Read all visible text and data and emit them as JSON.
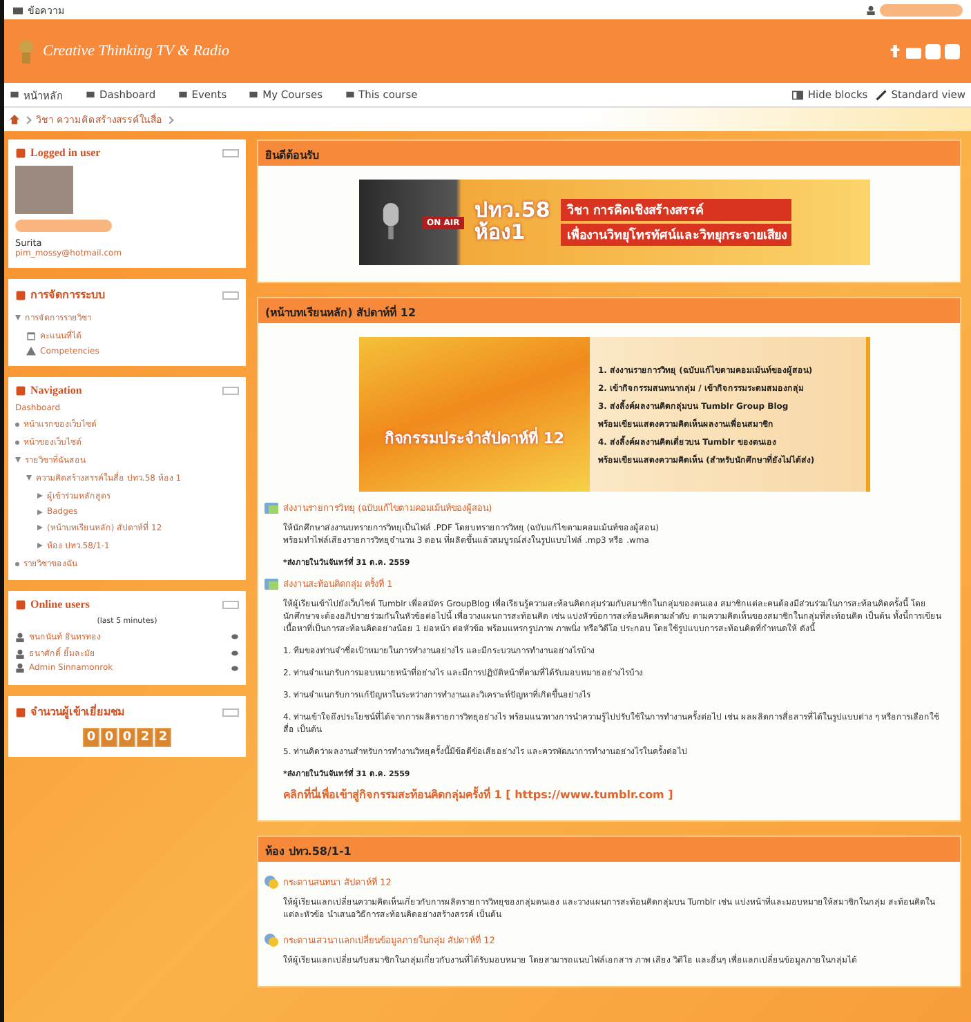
{
  "top_bar": {
    "messages": "ข้อความ"
  },
  "header": {
    "site_name": "Creative Thinking TV & Radio"
  },
  "nav": {
    "items": [
      {
        "label": "หน้าหลัก"
      },
      {
        "label": "Dashboard"
      },
      {
        "label": "Events"
      },
      {
        "label": "My Courses"
      },
      {
        "label": "This course"
      }
    ],
    "hide_blocks": "Hide blocks",
    "standard_view": "Standard view"
  },
  "breadcrumb": [
    "วิชา ความคิดสร้างสรรค์ในสื่อ"
  ],
  "blocks": [
    {
      "kind": "user",
      "title": "Logged in user",
      "name": "Surita",
      "email": "pim_mossy@hotmail.com"
    },
    {
      "kind": "tree",
      "title": "การจัดการระบบ",
      "items": [
        {
          "label": "การจัดการรายวิชา",
          "expanded": true,
          "children": [
            {
              "label": "คะแนนที่ได้"
            },
            {
              "label": "Competencies"
            }
          ]
        }
      ]
    },
    {
      "kind": "tree",
      "title": "Navigation",
      "lead": "Dashboard",
      "items": [
        {
          "label": "หน้าแรกของเว็บไซต์"
        },
        {
          "label": "หน้าของเว็บไซต์"
        },
        {
          "label": "รายวิชาที่ฉันสอน",
          "expanded": true,
          "children": [
            {
              "label": "ความคิดสร้างสรรค์ในสื่อ ปทว.58 ห้อง 1",
              "expanded": true,
              "children": [
                {
                  "label": "ผู้เข้าร่วมหลักสูตร",
                  "expanded": false
                },
                {
                  "label": "Badges",
                  "expanded": false
                },
                {
                  "label": "(หน้าบทเรียนหลัก) สัปดาห์ที่ 12",
                  "expanded": false
                },
                {
                  "label": "ห้อง ปทว.58/1-1",
                  "expanded": false
                }
              ]
            }
          ]
        },
        {
          "label": "รายวิชาของฉัน"
        }
      ]
    },
    {
      "kind": "online",
      "title": "Online users",
      "note": "(last 5 minutes)",
      "users": [
        "ชนกนันท์ อินทรทอง",
        "ธนาศักดิ์ ยิ้มละมัย",
        "Admin Sinnamonrok"
      ]
    },
    {
      "kind": "counter",
      "title": "จำนวนผู้เข้าเยี่ยมชม",
      "digits": [
        "0",
        "0",
        "0",
        "2",
        "2"
      ]
    }
  ],
  "sections": [
    {
      "title": "ยินดีต้อนรับ",
      "banner": {
        "kind": "welcome",
        "onair": "ON AIR",
        "big": "ปทว.58",
        "room": "ห้อง1",
        "line1": "วิชา การคิดเชิงสร้างสรรค์",
        "line2": "เพื่องานวิทยุโทรทัศน์และวิทยุกระจายเสียง"
      }
    },
    {
      "title": "(หน้าบทเรียนหลัก) สัปดาห์ที่ 12",
      "banner": {
        "kind": "week",
        "caption": "กิจกรรมประจำสัปดาห์ที่ 12",
        "lines": [
          "1. ส่งงานรายการวิทยุ (ฉบับแก้ไขตามคอมเม้นท์ของผู้สอน)",
          "2. เข้ากิจกรรมสนทนากลุ่ม / เข้ากิจกรรมระดมสมองกลุ่ม",
          "3. ส่งลิ้งค์ผลงานคิดกลุ่มบน Tumblr Group Blog",
          "พร้อมเขียนแสดงความคิดเห็นผลงานเพื่อนสมาชิก",
          "4. ส่งลิ้งค์ผลงานคิดเดี่ยวบน Tumblr ของตนเอง",
          "พร้อมเขียนแสดงความคิดเห็น (สำหรับนักศึกษาที่ยังไม่ได้ส่ง)"
        ]
      },
      "activities": [
        {
          "kind": "assignment",
          "title": "ส่งงานรายการวิทยุ (ฉบับแก้ไขตามคอมเม้นท์ของผู้สอน)",
          "body": [
            {
              "kind": "text",
              "text": "ให้นักศึกษาส่งงานบทรายการวิทยุเป็นไฟล์ .PDF โดยบทรายการวิทยุ (ฉบับแก้ไขตามคอมเม้นท์ของผู้สอน)\nพร้อมทำไฟล์เสียงรายการวิทยุจำนวน 3 ตอน ที่ผลิตขึ้นแล้วสมบูรณ์ส่งในรูปแบบไฟล์ .mp3 หรือ .wma"
            },
            {
              "kind": "deadline",
              "text": "*ส่งภายในวันจันทร์ที่ 31 ต.ค. 2559"
            }
          ]
        },
        {
          "kind": "assignment",
          "title": "ส่งงานสะท้อนคิดกลุ่ม ครั้งที่ 1",
          "body": [
            {
              "kind": "text",
              "text": "ให้ผู้เรียนเข้าไปยังเว็บไซต์ Tumblr เพื่อสมัคร GroupBlog เพื่อเรียนรู้ความสะท้อนคิดกลุ่มร่วมกับสมาชิกในกลุ่มของตนเอง สมาชิกแต่ละคนต้องมีส่วนร่วมในการสะท้อนคิดครั้งนี้ โดยนักศึกษาจะต้องอภิปรายร่วมกันในหัวข้อต่อไปนี้ เพื่อวางแผนการสะท้อนคิด เช่น แบ่งหัวข้อการสะท้อนคิดตามลำดับ ตามความคิดเห็นของสมาชิกในกลุ่มที่สะท้อนคิด เป็นต้น ทั้งนี้การเขียนเนื้อหาที่เป็นการสะท้อนคิดอย่างน้อย 1 ย่อหน้า ต่อหัวข้อ พร้อมแทรกรูปภาพ ภาพนิ่ง หรือวิดีโอ ประกอบ โดยใช้รูปแบบการสะท้อนคิดที่กำหนดให้ ดังนี้"
            },
            {
              "kind": "text",
              "text": "1. ทีมของท่านจำชื่อเป้าหมายในการทำงานอย่างไร และมีกระบวนการทำงานอย่างไรบ้าง"
            },
            {
              "kind": "text",
              "text": "2. ท่านจำแนกรับการมอบหมายหน้าที่อย่างไร และมีการปฏิบัติหน้าที่ตามที่ได้รับมอบหมายอย่างไรบ้าง"
            },
            {
              "kind": "text",
              "text": "3. ท่านจำแนกรับการแก้ปัญหาในระหว่างการทำงานและวิเคราะห์ปัญหาที่เกิดขึ้นอย่างไร"
            },
            {
              "kind": "text",
              "text": "4. ท่านเข้าใจถึงประโยชน์ที่ได้จากการผลิตรายการวิทยุอย่างไร พร้อมแนวทางการนำความรู้ไปปรับใช้ในการทำงานครั้งต่อไป เช่น ผลผลิตการสื่อสารที่ได้ในรูปแบบต่าง ๆ หรือการเลือกใช้สื่อ เป็นต้น"
            },
            {
              "kind": "text",
              "text": "5. ท่านคิดว่าผลงานสำหรับการทำงานวิทยุครั้งนี้มีข้อดีข้อเสียอย่างไร และควรพัฒนาการทำงานอย่างไรในครั้งต่อไป"
            },
            {
              "kind": "deadline",
              "text": "*ส่งภายในวันจันทร์ที่ 31 ต.ค. 2559"
            },
            {
              "kind": "link",
              "text": "คลิกที่นี่เพื่อเข้าสู่กิจกรรมสะท้อนคิดกลุ่มครั้งที่ 1 [ https://www.tumblr.com ]"
            }
          ]
        }
      ]
    },
    {
      "title": "ห้อง ปทว.58/1-1",
      "activities": [
        {
          "kind": "forum",
          "title": "กระดานสนทนา สัปดาห์ที่ 12",
          "body": [
            {
              "kind": "text",
              "text": "ให้ผู้เรียนแลกเปลี่ยนความคิดเห็นเกี่ยวกับการผลิตรายการวิทยุของกลุ่มตนเอง และวางแผนการสะท้อนคิดกลุ่มบน Tumblr เช่น แบ่งหน้าที่และมอบหมายให้สมาชิกในกลุ่ม สะท้อนคิดในแต่ละหัวข้อ นำเสนอวิธีการสะท้อนคิดอย่างสร้างสรรค์ เป็นต้น"
            }
          ]
        },
        {
          "kind": "forum",
          "title": "กระดานเสวนาแลกเปลี่ยนข้อมูลภายในกลุ่ม สัปดาห์ที่ 12",
          "body": [
            {
              "kind": "text",
              "text": "ให้ผู้เรียนแลกเปลี่ยนกับสมาชิกในกลุ่มเกี่ยวกับงานที่ได้รับมอบหมาย โดยสามารถแนบไฟล์เอกสาร ภาพ เสียง วิดีโอ และอื่นๆ เพื่อแลกเปลี่ยนข้อมูลภายในกลุ่มได้"
            }
          ]
        }
      ]
    }
  ]
}
